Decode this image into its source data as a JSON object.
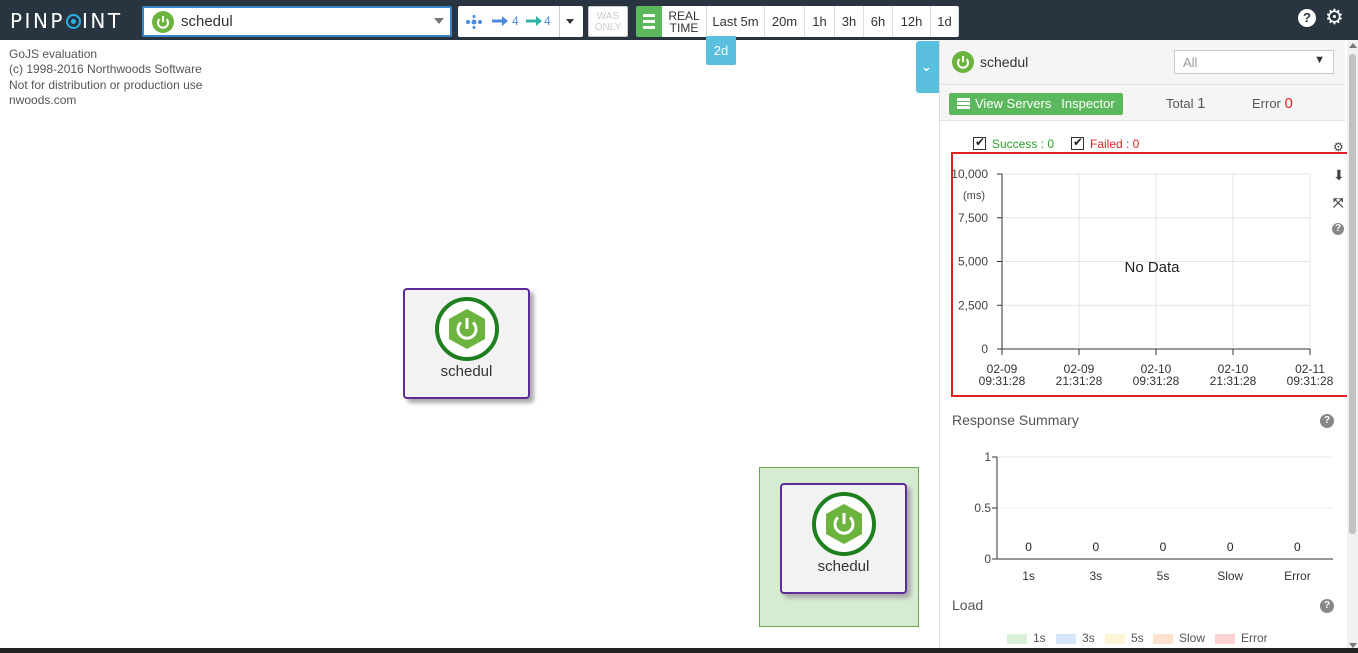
{
  "header": {
    "logo_text": "PINPOINT",
    "app_name": "schedul",
    "depth": {
      "caller": "4",
      "callee": "4"
    },
    "was_only": "WAS\nONLY",
    "realtime": "REAL TIME",
    "ranges": [
      "Last 5m",
      "20m",
      "1h",
      "3h",
      "6h",
      "12h",
      "1d"
    ],
    "selected_range": "2d"
  },
  "gojs_notice": [
    "GoJS evaluation",
    "(c) 1998-2016 Northwoods Software",
    "Not for distribution or production use",
    "nwoods.com"
  ],
  "nodes": [
    {
      "label": "schedul"
    },
    {
      "label": "schedul"
    }
  ],
  "panel": {
    "app_name": "schedul",
    "agent_filter": "All",
    "view_servers": "View Servers",
    "inspector": "Inspector",
    "total_label": "Total",
    "total_value": "1",
    "error_label": "Error",
    "error_value": "0",
    "success_label": "Success : 0",
    "failed_label": "Failed : 0",
    "colors": {
      "success": "#2ca02c",
      "failed": "#d62728",
      "error": "#e02020",
      "accent_green": "#5cb85c"
    }
  },
  "scatter": {
    "y_unit": "(ms)",
    "y_ticks": [
      "10,000",
      "7,500",
      "5,000",
      "2,500",
      "0"
    ],
    "x_ticks": [
      {
        "date": "02-09",
        "time": "09:31:28"
      },
      {
        "date": "02-09",
        "time": "21:31:28"
      },
      {
        "date": "02-10",
        "time": "09:31:28"
      },
      {
        "date": "02-10",
        "time": "21:31:28"
      },
      {
        "date": "02-11",
        "time": "09:31:28"
      }
    ],
    "no_data": "No Data"
  },
  "chart_data": [
    {
      "type": "scatter",
      "ylabel": "(ms)",
      "ylim": [
        0,
        10000
      ],
      "x": [
        "02-09 09:31:28",
        "02-09 21:31:28",
        "02-10 09:31:28",
        "02-10 21:31:28",
        "02-11 09:31:28"
      ],
      "series": [],
      "annotation": "No Data"
    },
    {
      "type": "bar",
      "title": "Response Summary",
      "categories": [
        "1s",
        "3s",
        "5s",
        "Slow",
        "Error"
      ],
      "values": [
        0,
        0,
        0,
        0,
        0
      ],
      "ylim": [
        0,
        1
      ],
      "y_ticks": [
        "1",
        "0.5",
        "0"
      ]
    },
    {
      "type": "bar",
      "title": "Load",
      "series": [
        {
          "name": "1s",
          "color": "#d9f0d9"
        },
        {
          "name": "3s",
          "color": "#d6e6fb"
        },
        {
          "name": "5s",
          "color": "#fdf4d6"
        },
        {
          "name": "Slow",
          "color": "#fde3cf"
        },
        {
          "name": "Error",
          "color": "#fbd3d3"
        }
      ]
    }
  ],
  "response_summary": {
    "title": "Response Summary",
    "y_ticks": [
      "1",
      "0.5",
      "0"
    ],
    "categories": [
      "1s",
      "3s",
      "5s",
      "Slow",
      "Error"
    ],
    "values": [
      "0",
      "0",
      "0",
      "0",
      "0"
    ]
  },
  "load": {
    "title": "Load"
  }
}
